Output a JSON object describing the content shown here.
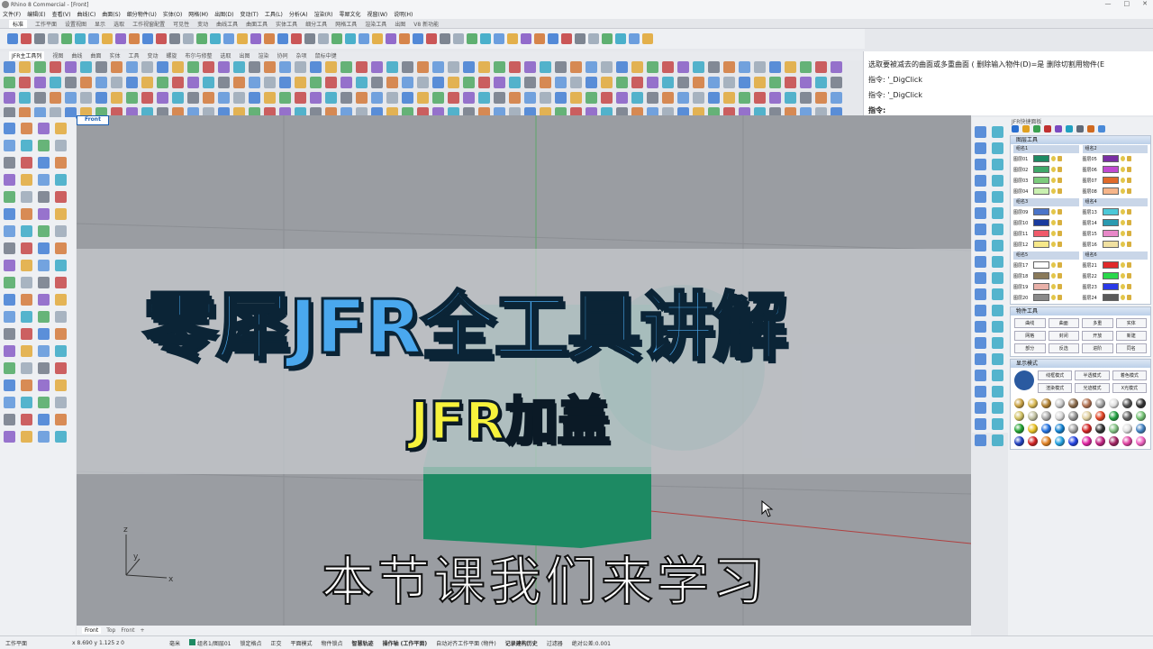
{
  "window": {
    "title": "Rhino 8 Commercial - [Front]",
    "controls": [
      "—",
      "□",
      "✕"
    ]
  },
  "menu": [
    "文件(F)",
    "编辑(E)",
    "查看(V)",
    "曲线(C)",
    "曲面(S)",
    "细分物件(U)",
    "实体(O)",
    "网格(M)",
    "出图(D)",
    "变动(T)",
    "工具(L)",
    "分析(A)",
    "渲染(R)",
    "零犀文化",
    "视窗(W)",
    "说明(H)"
  ],
  "tabs": {
    "items": [
      "标准",
      "工作平面",
      "设置视图",
      "显示",
      "选取",
      "工作视窗配置",
      "可见性",
      "变动",
      "曲线工具",
      "曲面工具",
      "实体工具",
      "细分工具",
      "网格工具",
      "渲染工具",
      "出图",
      "V8 新功能"
    ],
    "active": "标准"
  },
  "main_tabs": {
    "items": [
      "JFR主工具列",
      "视图",
      "曲线",
      "曲面",
      "实体",
      "工具",
      "变动",
      "螺旋",
      "布尔与修整",
      "选取",
      "出图",
      "渲染",
      "协同",
      "杂项",
      "鼠标中键"
    ],
    "active": "JFR主工具列"
  },
  "command": {
    "lines": [
      "选取要被减去的曲面或多重曲面 ( 删除输入物件(D)=是  删除切割用物件(E",
      "指令: '_DigClick",
      "指令: '_DigClick"
    ],
    "prompt": "指令:"
  },
  "viewport": {
    "label": "Front",
    "tabs": [
      "Front",
      "Top",
      "Front",
      "+"
    ],
    "active_tab": "Front",
    "axis": {
      "z": "z",
      "y": "y",
      "x": "x"
    }
  },
  "overlay": {
    "title": "零犀JFR全工具讲解",
    "subtitle": "JFR加盖",
    "caption": "本节课我们来学习"
  },
  "right_panel": {
    "title": "JFR快捷面板",
    "layer_tool": {
      "title": "图层工具",
      "groups": [
        {
          "name": "组名1",
          "layers": [
            {
              "n": "图层01",
              "c": "#1d8a63"
            },
            {
              "n": "图层02",
              "c": "#3fa86a"
            },
            {
              "n": "图层03",
              "c": "#7ccc7c"
            },
            {
              "n": "图层04",
              "c": "#c9f0b0"
            }
          ]
        },
        {
          "name": "组名2",
          "layers": [
            {
              "n": "图层05",
              "c": "#7a2fa4"
            },
            {
              "n": "图层06",
              "c": "#c04ad0"
            },
            {
              "n": "图层07",
              "c": "#e06a2a"
            },
            {
              "n": "图层08",
              "c": "#f6b58a"
            }
          ]
        },
        {
          "name": "组名3",
          "layers": [
            {
              "n": "图层09",
              "c": "#4a74c8"
            },
            {
              "n": "图层10",
              "c": "#1a3b9e"
            },
            {
              "n": "图层11",
              "c": "#f05a6a"
            },
            {
              "n": "图层12",
              "c": "#f6e88a"
            }
          ]
        },
        {
          "name": "组名4",
          "layers": [
            {
              "n": "图层13",
              "c": "#4cc8d8"
            },
            {
              "n": "图层14",
              "c": "#2a9ab0"
            },
            {
              "n": "图层15",
              "c": "#e888c8"
            },
            {
              "n": "图层16",
              "c": "#f0e0a0"
            }
          ]
        },
        {
          "name": "组名5",
          "layers": [
            {
              "n": "图层17",
              "c": "#ffffff"
            },
            {
              "n": "图层18",
              "c": "#8a7a5a"
            },
            {
              "n": "图层19",
              "c": "#e8b0a8"
            },
            {
              "n": "图层20",
              "c": "#8a8a8a"
            }
          ]
        },
        {
          "name": "组名6",
          "layers": [
            {
              "n": "图层21",
              "c": "#e02a2a"
            },
            {
              "n": "图层22",
              "c": "#2ad84a"
            },
            {
              "n": "图层23",
              "c": "#2a3ae8"
            },
            {
              "n": "图层24",
              "c": "#5a5a5a"
            }
          ]
        }
      ]
    },
    "object_tool": {
      "title": "物件工具",
      "buttons": [
        "曲线",
        "曲面",
        "多重",
        "实体",
        "网格",
        "封闭",
        "开放",
        "新建",
        "部分",
        "反选",
        "进阶",
        "同名"
      ]
    },
    "display_mode": {
      "title": "显示模式",
      "buttons": [
        "线框模式",
        "半透模式",
        "着色模式",
        "渲染模式",
        "光迹模式",
        "X光模式"
      ]
    },
    "materials": [
      "#c8a040",
      "#d8b850",
      "#b08030",
      "#c8c8c8",
      "#8a6a4a",
      "#b07050",
      "#a0a0a0",
      "#e0e0e0",
      "#505050",
      "#303030",
      "#d0c060",
      "#c0c0a0",
      "#a8a8a8",
      "#d8d8d8",
      "#909090",
      "#e0d0a0",
      "#e04020",
      "#20a040",
      "#606060",
      "#70c070",
      "#20a030",
      "#e8c020",
      "#2070e0",
      "#1080d0",
      "#a0a0a0",
      "#d02020",
      "#303030",
      "#80c080",
      "#e0e0e0",
      "#4080c0",
      "#2040c0",
      "#d02020",
      "#e08020",
      "#20a0e0",
      "#2040e0",
      "#e020a0",
      "#c02080",
      "#a02060",
      "#e040a0",
      "#f060c0"
    ]
  },
  "status": {
    "workplane": "工作平面",
    "coords": "x 8.690  y 1.125  z 0",
    "unit": "毫米",
    "layer": "组名1/图层01",
    "items": [
      "锁定格点",
      "正交",
      "平面模式",
      "物件锁点",
      "智慧轨迹",
      "操作轴 (工作平面)",
      "自动对齐工作平面 (物件)",
      "记录建构历史",
      "过滤器",
      "绝对公差:0.001"
    ],
    "bold": [
      "智慧轨迹",
      "操作轴 (工作平面)",
      "记录建构历史"
    ]
  },
  "colors": {
    "accent": "#1a5fb4",
    "title_fill": "#4aa8ee",
    "subtitle_fill": "#f6f23c",
    "box_green": "#1d8a63"
  }
}
